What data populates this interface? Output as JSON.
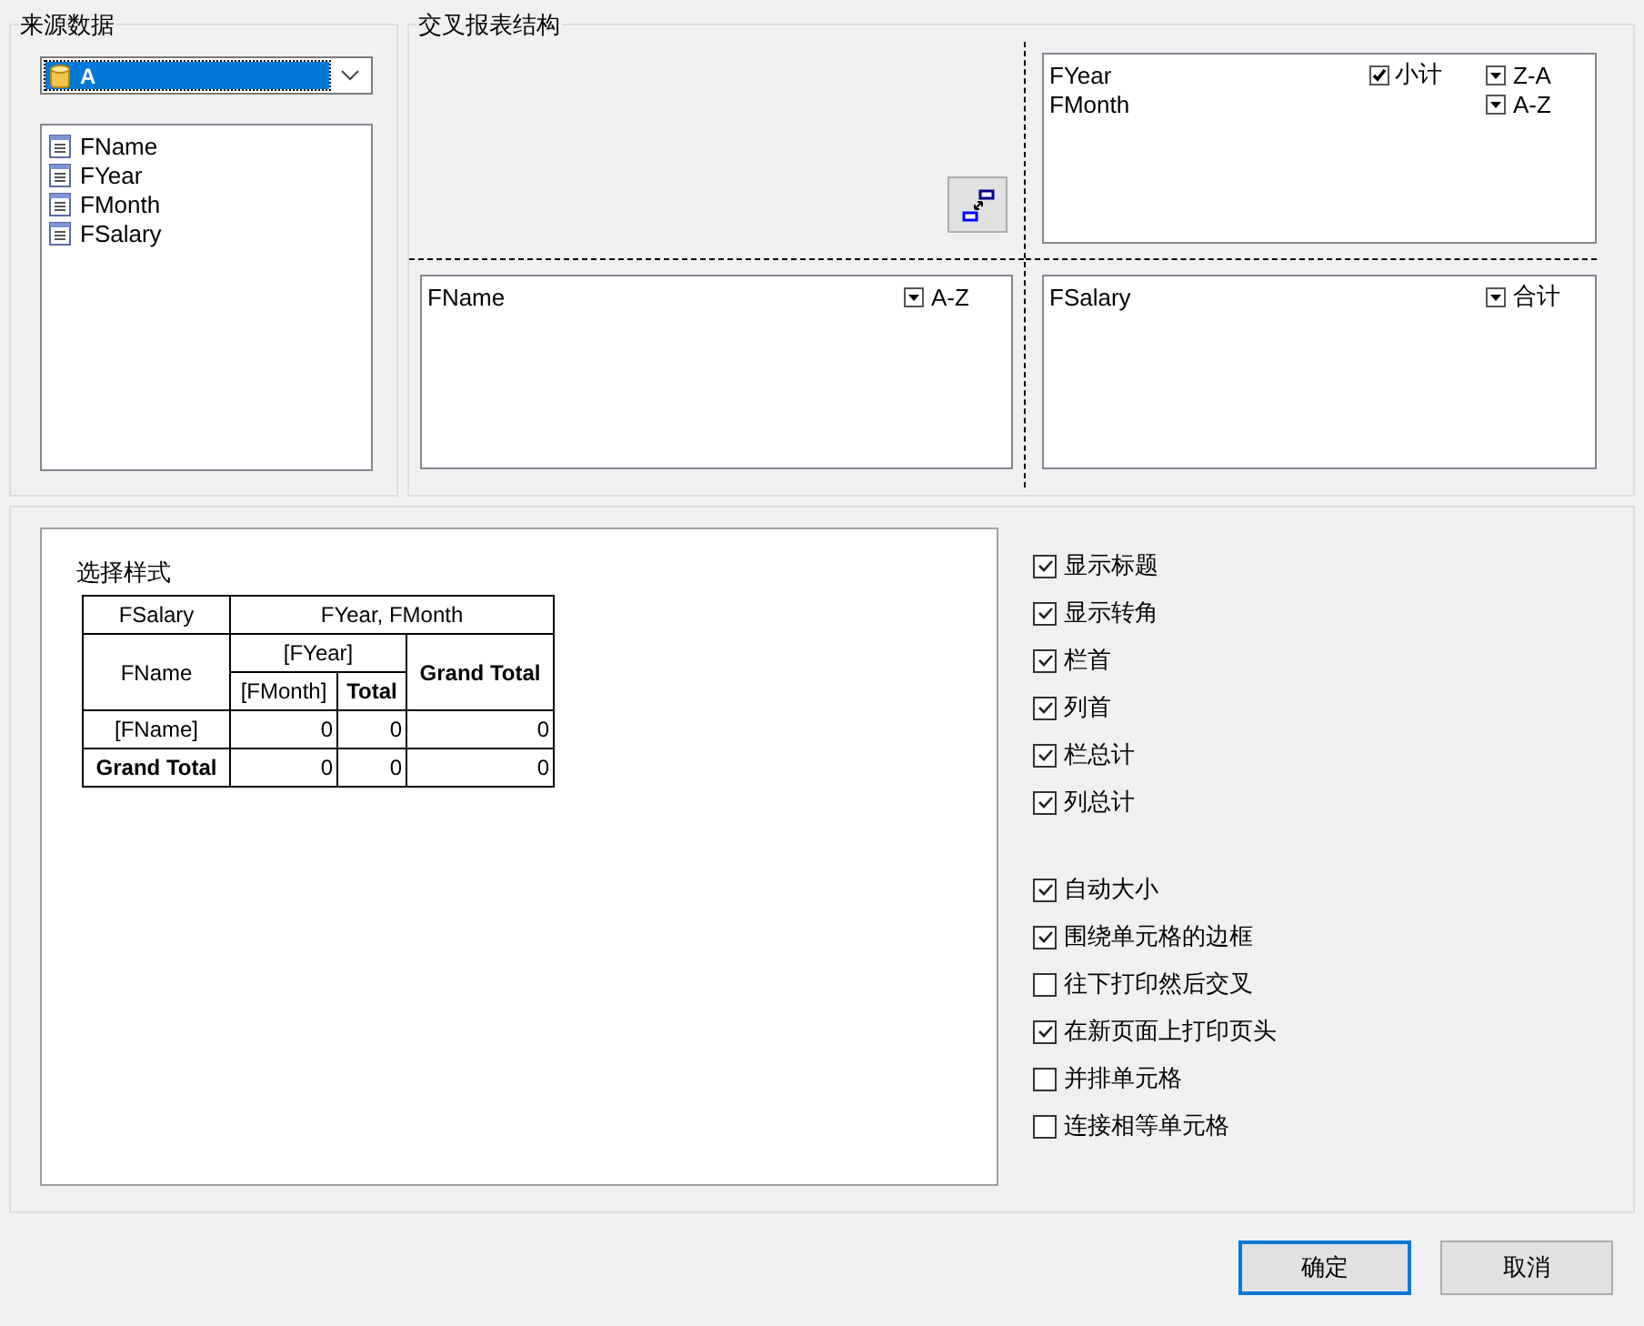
{
  "source": {
    "title": "来源数据",
    "dataset": "A",
    "fields": [
      "FName",
      "FYear",
      "FMonth",
      "FSalary"
    ]
  },
  "structure": {
    "title": "交叉报表结构",
    "columns": [
      {
        "name": "FYear",
        "subtotal": {
          "label": "小计",
          "checked": true
        },
        "sort": "Z-A"
      },
      {
        "name": "FMonth",
        "sort": "A-Z"
      }
    ],
    "rows": [
      {
        "name": "FName",
        "sort": "A-Z"
      }
    ],
    "values": [
      {
        "name": "FSalary",
        "aggregate": "合计"
      }
    ]
  },
  "preview": {
    "title": "选择样式",
    "table": {
      "corner": "FSalary",
      "column_fields": "FYear, FMonth",
      "row_field": "FName",
      "column_group": "[FYear]",
      "column_item": "[FMonth]",
      "subtotal": "Total",
      "grand_total_column": "Grand Total",
      "rows": [
        {
          "label": "[FName]",
          "kind": "detail",
          "values": [
            "0",
            "0",
            "0"
          ]
        },
        {
          "label": "Grand Total",
          "kind": "total",
          "values": [
            "0",
            "0",
            "0"
          ]
        }
      ]
    }
  },
  "options": {
    "display": [
      {
        "label": "显示标题",
        "checked": true
      },
      {
        "label": "显示转角",
        "checked": true
      },
      {
        "label": "栏首",
        "checked": true
      },
      {
        "label": "列首",
        "checked": true
      },
      {
        "label": "栏总计",
        "checked": true
      },
      {
        "label": "列总计",
        "checked": true
      }
    ],
    "print": [
      {
        "label": "自动大小",
        "checked": true
      },
      {
        "label": "围绕单元格的边框",
        "checked": true
      },
      {
        "label": "往下打印然后交叉",
        "checked": false
      },
      {
        "label": "在新页面上打印页头",
        "checked": true
      },
      {
        "label": "并排单元格",
        "checked": false
      },
      {
        "label": "连接相等单元格",
        "checked": false
      }
    ]
  },
  "buttons": [
    {
      "label": "确定",
      "default": true
    },
    {
      "label": "取消",
      "default": false
    }
  ]
}
